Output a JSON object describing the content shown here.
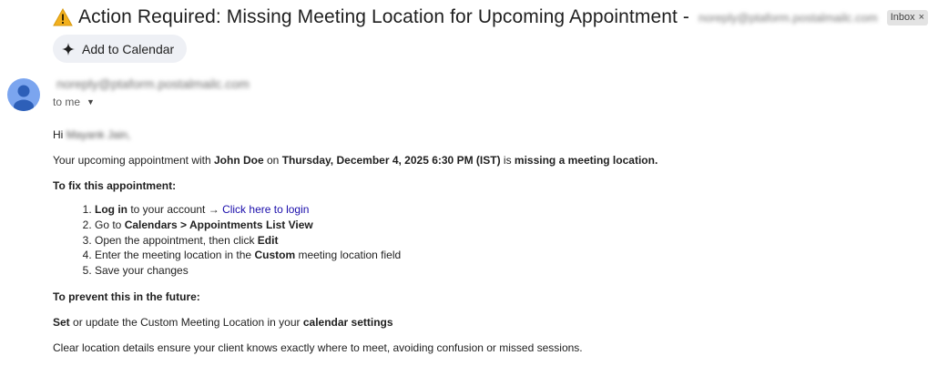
{
  "email": {
    "subject": "Action Required: Missing Meeting Location for Upcoming Appointment -",
    "subject_sender_blurred": "noreply@ptaform.postalmailc.com",
    "label_chip": "Inbox",
    "add_to_calendar": "Add to Calendar",
    "sender_blurred": "noreply@ptaform.postalmailc.com",
    "to_me": "to me",
    "greeting_prefix": "Hi",
    "greeting_name_blurred": "Mayank Jain,",
    "intro": {
      "p1": "Your upcoming appointment with ",
      "name": "John Doe",
      "p2": " on ",
      "datetime": "Thursday, December 4, 2025 6:30 PM (IST)",
      "p3": " is ",
      "missing": "missing a meeting location."
    },
    "fix_heading": "To fix this appointment:",
    "steps": {
      "s1_bold": "Log in",
      "s1_text": " to your account → ",
      "s1_link": "Click here to login",
      "s2_text": "Go to ",
      "s2_bold": "Calendars > Appointments List View",
      "s3_text": "Open the appointment, then click ",
      "s3_bold": "Edit",
      "s4_text": "Enter the meeting location in the ",
      "s4_bold": "Custom",
      "s4_text2": " meeting location field",
      "s5_text": "Save your changes"
    },
    "prevent_heading": "To prevent this in the future:",
    "prevent": {
      "bold1": "Set",
      "text1": " or update the Custom Meeting Location in your ",
      "bold2": "calendar settings"
    },
    "closing": "Clear location details ensure your client knows exactly where to meet, avoiding confusion or missed sessions."
  },
  "icons": {
    "subject_icon": "warning-icon",
    "calendar_button_icon": "sparkle-icon",
    "avatar_icon": "person-icon",
    "to_me_icon": "caret-down-icon"
  },
  "colors": {
    "link": "#1a0dab",
    "avatar": "#7ba5ef",
    "warning": "#f2b01e"
  }
}
